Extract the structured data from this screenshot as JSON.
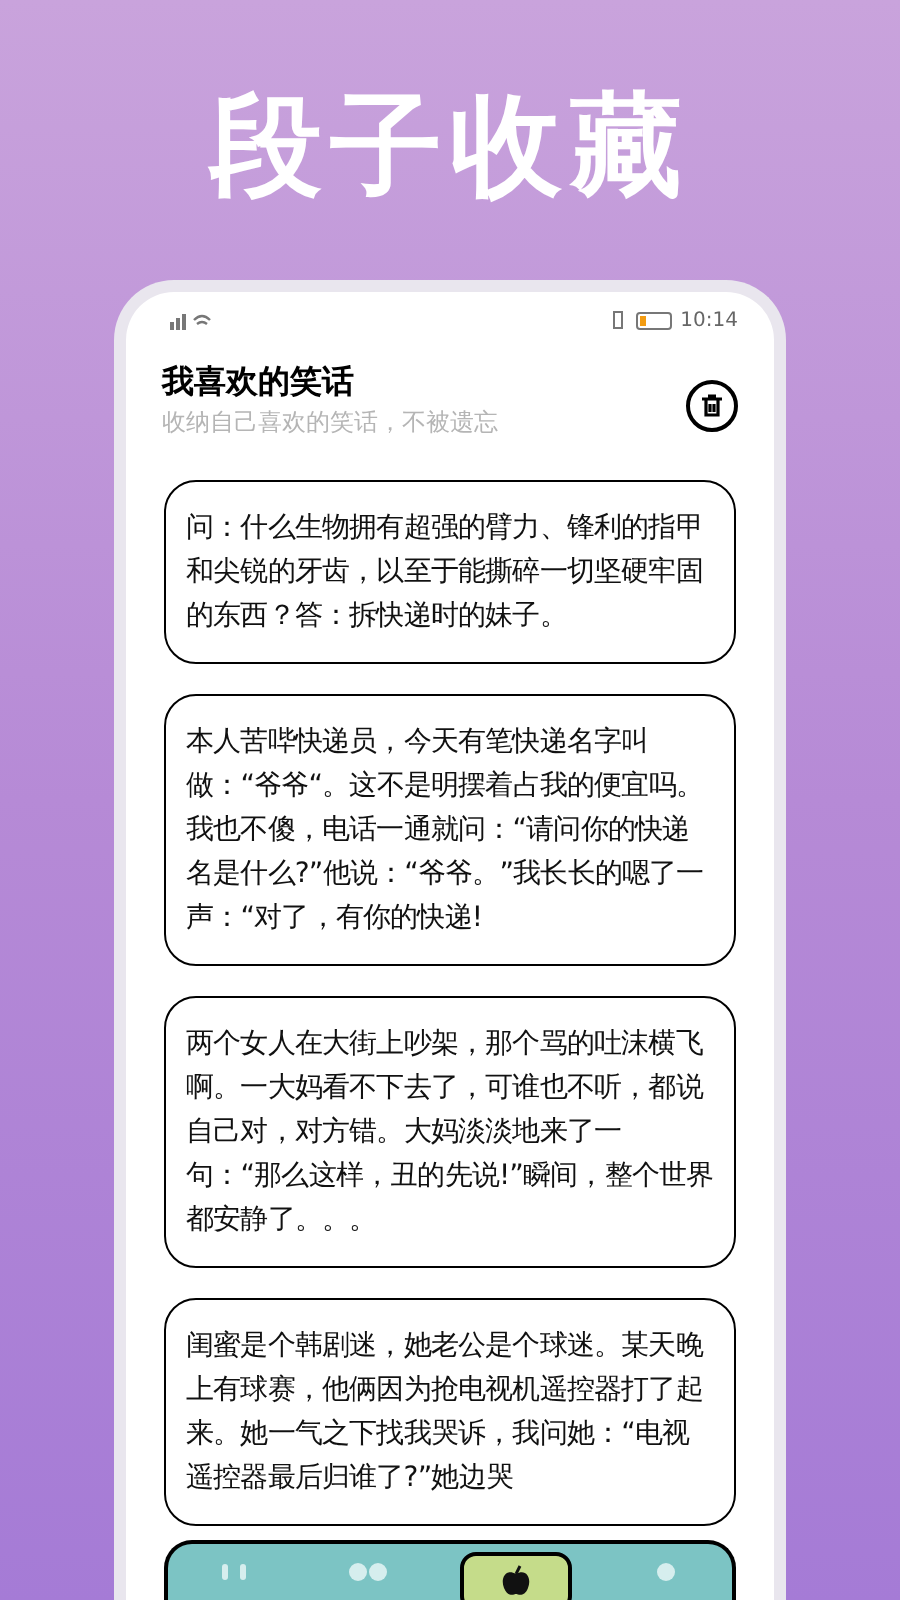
{
  "banner": {
    "title": "段子收藏"
  },
  "status_bar": {
    "time": "10:14"
  },
  "header": {
    "title": "我喜欢的笑话",
    "subtitle": "收纳自己喜欢的笑话，不被遗忘"
  },
  "jokes": [
    {
      "text": "问：什么生物拥有超强的臂力、锋利的指甲和尖锐的牙齿，以至于能撕碎一切坚硬牢固的东西？答：拆快递时的妹子。"
    },
    {
      "text": "本人苦哔快递员，今天有笔快递名字叫做：“爷爷“。这不是明摆着占我的便宜吗。我也不傻，电话一通就问：“请问你的快递名是什么?”他说：“爷爷。”我长长的嗯了一声：“对了，有你的快递!"
    },
    {
      "text": "两个女人在大街上吵架，那个骂的吐沫横飞啊。一大妈看不下去了，可谁也不听，都说自己对，对方错。大妈淡淡地来了一句：“那么这样，丑的先说!”瞬间，整个世界都安静了。。。"
    },
    {
      "text": "闺蜜是个韩剧迷，她老公是个球迷。某天晚上有球赛，他俩因为抢电视机遥控器打了起来。她一气之下找我哭诉，我问她：“电视遥控器最后归谁了?”她边哭"
    }
  ],
  "nav": [
    {
      "kind": "bars",
      "selected": false
    },
    {
      "kind": "dots",
      "selected": false
    },
    {
      "kind": "apple",
      "selected": true
    },
    {
      "kind": "dot",
      "selected": false
    }
  ]
}
